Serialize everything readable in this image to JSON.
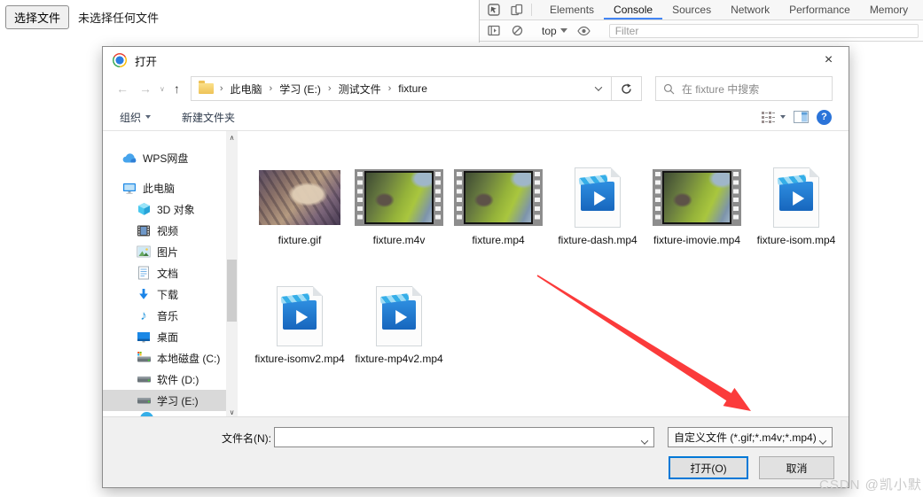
{
  "page": {
    "choose_file_button": "选择文件",
    "no_file_text": "未选择任何文件"
  },
  "devtools": {
    "tabs": [
      {
        "label": "Elements",
        "active": false
      },
      {
        "label": "Console",
        "active": true
      },
      {
        "label": "Sources",
        "active": false
      },
      {
        "label": "Network",
        "active": false
      },
      {
        "label": "Performance",
        "active": false
      },
      {
        "label": "Memory",
        "active": false
      }
    ],
    "context": "top",
    "filter_placeholder": "Filter"
  },
  "dialog": {
    "title": "打开",
    "close_label": "×",
    "breadcrumb": [
      "此电脑",
      "学习 (E:)",
      "测试文件",
      "fixture"
    ],
    "search_placeholder": "在 fixture 中搜索",
    "toolbar": {
      "organize": "组织",
      "new_folder": "新建文件夹"
    },
    "sidebar": [
      {
        "label": "WPS网盘",
        "icon": "cloud",
        "indent": 0,
        "selected": false,
        "group_start": false
      },
      {
        "label": "此电脑",
        "icon": "computer",
        "indent": 0,
        "selected": false,
        "group_start": true
      },
      {
        "label": "3D 对象",
        "icon": "cube",
        "indent": 1,
        "selected": false,
        "group_start": false
      },
      {
        "label": "视频",
        "icon": "film",
        "indent": 1,
        "selected": false,
        "group_start": false
      },
      {
        "label": "图片",
        "icon": "picture",
        "indent": 1,
        "selected": false,
        "group_start": false
      },
      {
        "label": "文档",
        "icon": "document",
        "indent": 1,
        "selected": false,
        "group_start": false
      },
      {
        "label": "下载",
        "icon": "download",
        "indent": 1,
        "selected": false,
        "group_start": false
      },
      {
        "label": "音乐",
        "icon": "music",
        "indent": 1,
        "selected": false,
        "group_start": false
      },
      {
        "label": "桌面",
        "icon": "desktop",
        "indent": 1,
        "selected": false,
        "group_start": false
      },
      {
        "label": "本地磁盘 (C:)",
        "icon": "drive-windows",
        "indent": 1,
        "selected": false,
        "group_start": false
      },
      {
        "label": "软件 (D:)",
        "icon": "drive",
        "indent": 1,
        "selected": false,
        "group_start": false
      },
      {
        "label": "学习 (E:)",
        "icon": "drive",
        "indent": 1,
        "selected": true,
        "group_start": false
      }
    ],
    "files": [
      {
        "name": "fixture.gif",
        "thumb": "cat-image"
      },
      {
        "name": "fixture.m4v",
        "thumb": "filmstrip"
      },
      {
        "name": "fixture.mp4",
        "thumb": "filmstrip"
      },
      {
        "name": "fixture-dash.mp4",
        "thumb": "video-file"
      },
      {
        "name": "fixture-imovie.mp4",
        "thumb": "filmstrip"
      },
      {
        "name": "fixture-isom.mp4",
        "thumb": "video-file"
      },
      {
        "name": "fixture-isomv2.mp4",
        "thumb": "video-file"
      },
      {
        "name": "fixture-mp4v2.mp4",
        "thumb": "video-file"
      }
    ],
    "footer": {
      "filename_label": "文件名(N):",
      "filename_value": "",
      "filetype_value": "自定义文件 (*.gif;*.m4v;*.mp4)",
      "open_button": "打开(O)",
      "cancel_button": "取消"
    }
  },
  "icons": {
    "back_arrow": "←",
    "forward_arrow": "→",
    "up_arrow": "↑",
    "history_chevron": "∨",
    "breadcrumb_separator": "›",
    "scroll_up": "∧",
    "scroll_down": "∨",
    "help_glyph": "?"
  },
  "watermark": "CSDN @凯小默",
  "colors": {
    "devtools_accent": "#4285f4",
    "selection_gray": "#d9d9d9",
    "arrow_red": "#fb3b3b",
    "open_button_border": "#0078d7"
  }
}
